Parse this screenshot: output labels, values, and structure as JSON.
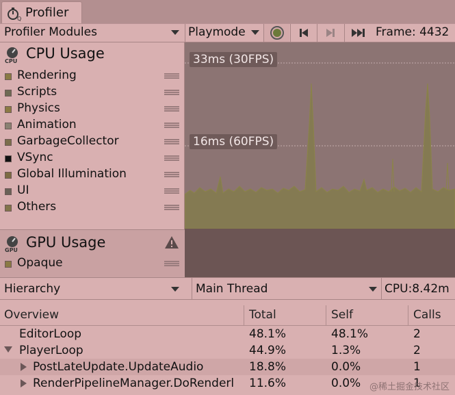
{
  "window": {
    "tab_title": "Profiler",
    "tab_icon": "profiler-stopwatch-icon"
  },
  "toolbar": {
    "modules_dropdown": "Profiler Modules",
    "mode_dropdown": "Playmode",
    "record_icon": "record-icon",
    "prev_frame_icon": "prev-frame-icon",
    "next_frame_icon": "next-frame-icon",
    "current_frame_icon": "current-frame-icon",
    "frame_label": "Frame: 4432"
  },
  "modules": {
    "cpu": {
      "title": "CPU Usage",
      "icon_text": "CPU",
      "items": [
        {
          "label": "Rendering",
          "color": "#8a7a44"
        },
        {
          "label": "Scripts",
          "color": "#6f6a54"
        },
        {
          "label": "Physics",
          "color": "#8c7a44"
        },
        {
          "label": "Animation",
          "color": "#8a8172"
        },
        {
          "label": "GarbageCollector",
          "color": "#7c6e4c"
        },
        {
          "label": "VSync",
          "color": "#111111"
        },
        {
          "label": "Global Illumination",
          "color": "#7c6b42"
        },
        {
          "label": "UI",
          "color": "#6a6157"
        },
        {
          "label": "Others",
          "color": "#82744a"
        }
      ]
    },
    "gpu": {
      "title": "GPU Usage",
      "icon_text": "GPU",
      "warning_icon": "warning-icon",
      "items": [
        {
          "label": "Opaque",
          "color": "#8a7a44"
        }
      ]
    }
  },
  "chart": {
    "line_30fps": "33ms (30FPS)",
    "line_60fps": "16ms (60FPS)",
    "colors": {
      "background": "#8c7473",
      "series": "#8b8448",
      "guide": "#c4adad"
    }
  },
  "hierarchy_bar": {
    "view_dropdown": "Hierarchy",
    "thread_dropdown": "Main Thread",
    "cpu_time": "CPU:8.42m"
  },
  "table": {
    "columns": [
      "Overview",
      "Total",
      "Self",
      "Calls"
    ],
    "rows": [
      {
        "name": "EditorLoop",
        "total": "48.1%",
        "self": "48.1%",
        "calls": "2"
      },
      {
        "name": "PlayerLoop",
        "total": "44.9%",
        "self": "1.3%",
        "calls": "2"
      },
      {
        "name": "PostLateUpdate.UpdateAudio",
        "total": "18.8%",
        "self": "0.0%",
        "calls": "1"
      },
      {
        "name": "RenderPipelineManager.DoRenderl",
        "total": "11.6%",
        "self": "0.0%",
        "calls": "1"
      }
    ]
  },
  "watermark": "@稀土掘金技术社区"
}
